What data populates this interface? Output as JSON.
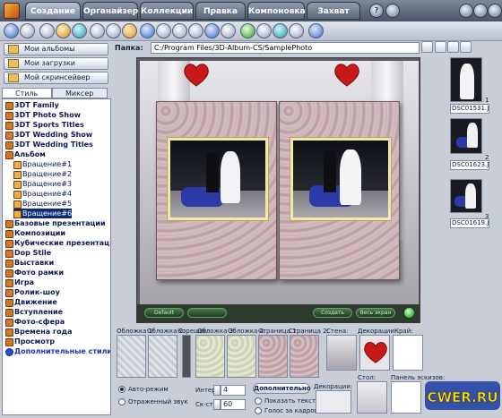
{
  "tabs": [
    {
      "label": "Создание"
    },
    {
      "label": "Органайзер"
    },
    {
      "label": "Коллекции"
    },
    {
      "label": "Правка"
    },
    {
      "label": "Компоновка"
    },
    {
      "label": "Захват"
    }
  ],
  "window_buttons": [
    "?"
  ],
  "left_buttons": [
    {
      "label": "Мои альбомы"
    },
    {
      "label": "Мои загрузки"
    },
    {
      "label": "Мой скринсейвер"
    }
  ],
  "panel_tabs": [
    {
      "label": "Стиль"
    },
    {
      "label": "Миксер"
    }
  ],
  "tree": [
    {
      "label": "3DT Family"
    },
    {
      "label": "3DT Photo Show"
    },
    {
      "label": "3DT Sports Titles"
    },
    {
      "label": "3DT Wedding Show"
    },
    {
      "label": "3DT Wedding Titles"
    },
    {
      "label": "Альбом"
    },
    {
      "label": "Вращение#1"
    },
    {
      "label": "Вращение#2"
    },
    {
      "label": "Вращение#3"
    },
    {
      "label": "Вращение#4"
    },
    {
      "label": "Вращение#5"
    },
    {
      "label": "Вращение#6"
    },
    {
      "label": "Базовые презентации"
    },
    {
      "label": "Композиции"
    },
    {
      "label": "Кубические презентации"
    },
    {
      "label": "Dop Stile"
    },
    {
      "label": "Выставки"
    },
    {
      "label": "Фото рамки"
    },
    {
      "label": "Игра"
    },
    {
      "label": "Ролик-шоу"
    },
    {
      "label": "Движение"
    },
    {
      "label": "Вступление"
    },
    {
      "label": "Фото-сфера"
    },
    {
      "label": "Времена года"
    },
    {
      "label": "Просмотр"
    },
    {
      "label": "Дополнительные стили"
    }
  ],
  "path": {
    "label": "Папка:",
    "value": "C:/Program Files/3D-Album-CS/SamplePhoto"
  },
  "viewer": {
    "default_label": "Default",
    "slider_label": "",
    "btn2": "Создать",
    "btn3": "Весь экран"
  },
  "thumbnails": [
    {
      "name": "DSC01531.JI",
      "index": "1"
    },
    {
      "name": "DSC01623.JI",
      "index": "2"
    },
    {
      "name": "DSC01619.JI",
      "index": "3"
    }
  ],
  "bottom": {
    "labels": [
      "Обложка 1:",
      "Обложка 2:",
      "Корешок:",
      "Обложка 3:",
      "Обложка 4:",
      "Страница 1:",
      "Страница 2:",
      "Стена:",
      "Декорации:",
      "Край:"
    ],
    "auto_mode": "Авто-режим",
    "reflect_sound": "Отраженный звук",
    "interval_label": "Интер",
    "interval_value": "4",
    "speed_label": "Ск-сть",
    "speed_value": "60",
    "extra_button": "Дополнительно",
    "show_text": "Показать текст",
    "voice_over": "Голос за кадром",
    "decorations2": "Декорации:",
    "table": "Стол:",
    "sketch_panel": "Панель эскизов:",
    "watermark": "CWER.RU"
  },
  "colors": {
    "accent": "#0a2a78",
    "selection_text": "#ffffff",
    "watermark": "#f0e020"
  }
}
